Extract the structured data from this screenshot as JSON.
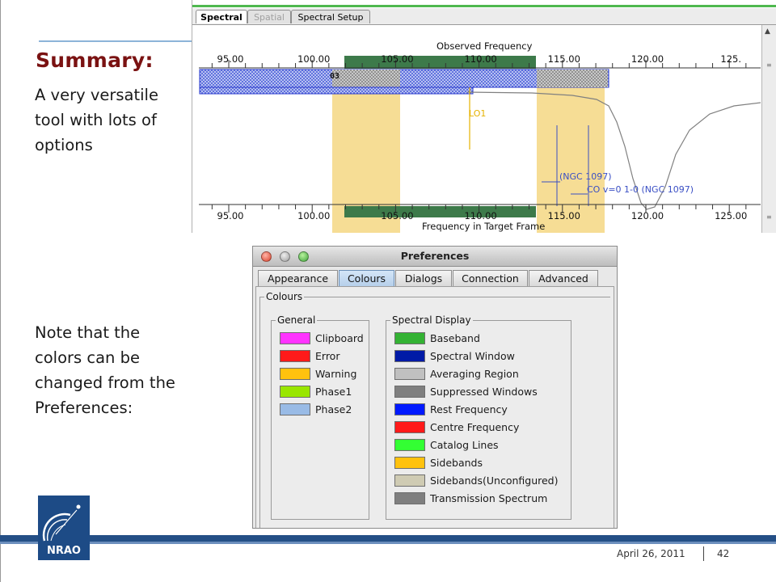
{
  "slide": {
    "title": "Summary:",
    "body1": "A very versatile tool with lots of options",
    "body2": "Note that the colors can be changed from the Preferences:"
  },
  "spectral_window": {
    "tabs": [
      {
        "label": "Spectral",
        "state": "active"
      },
      {
        "label": "Spatial",
        "state": "disabled"
      },
      {
        "label": "Spectral Setup",
        "state": "normal"
      }
    ],
    "top_axis_label": "Observed Frequency",
    "top_ticks": [
      "95.00",
      "100.00",
      "105.00",
      "110.00",
      "115.00",
      "120.00",
      "125."
    ],
    "bottom_axis_label": "Frequency in Target Frame",
    "bottom_ticks": [
      "95.00",
      "100.00",
      "105.00",
      "110.00",
      "115.00",
      "120.00",
      "125.00"
    ],
    "window_label": "03",
    "lo_label": "LO1",
    "line_labels": [
      "(NGC 1097)",
      "CO  v=0 1-0 (NGC 1097)"
    ]
  },
  "preferences": {
    "title": "Preferences",
    "tabs": [
      {
        "label": "Appearance",
        "active": false
      },
      {
        "label": "Colours",
        "active": true
      },
      {
        "label": "Dialogs",
        "active": false
      },
      {
        "label": "Connection",
        "active": false
      },
      {
        "label": "Advanced",
        "active": false
      }
    ],
    "colours_group": "Colours",
    "general_group": "General",
    "spectral_group": "Spectral Display",
    "general": [
      {
        "label": "Clipboard",
        "color": "#ff33ff"
      },
      {
        "label": "Error",
        "color": "#ff1a1a"
      },
      {
        "label": "Warning",
        "color": "#ffc20e"
      },
      {
        "label": "Phase1",
        "color": "#99e600"
      },
      {
        "label": "Phase2",
        "color": "#99bbe6"
      }
    ],
    "spectral": [
      {
        "label": "Baseband",
        "color": "#33b233"
      },
      {
        "label": "Spectral Window",
        "color": "#001aa6"
      },
      {
        "label": "Averaging Region",
        "color": "#c0c0c0"
      },
      {
        "label": "Suppressed Windows",
        "color": "#7f7f7f"
      },
      {
        "label": "Rest Frequency",
        "color": "#0019ff"
      },
      {
        "label": "Centre Frequency",
        "color": "#ff1a1a"
      },
      {
        "label": "Catalog Lines",
        "color": "#33ff33"
      },
      {
        "label": "Sidebands",
        "color": "#ffc20e"
      },
      {
        "label": "Sidebands(Unconfigured)",
        "color": "#cfcbb3"
      },
      {
        "label": "Transmission Spectrum",
        "color": "#7f7f7f"
      }
    ]
  },
  "logo": {
    "text": "NRAO"
  },
  "footer": {
    "date": "April 26, 2011",
    "page": "42"
  }
}
